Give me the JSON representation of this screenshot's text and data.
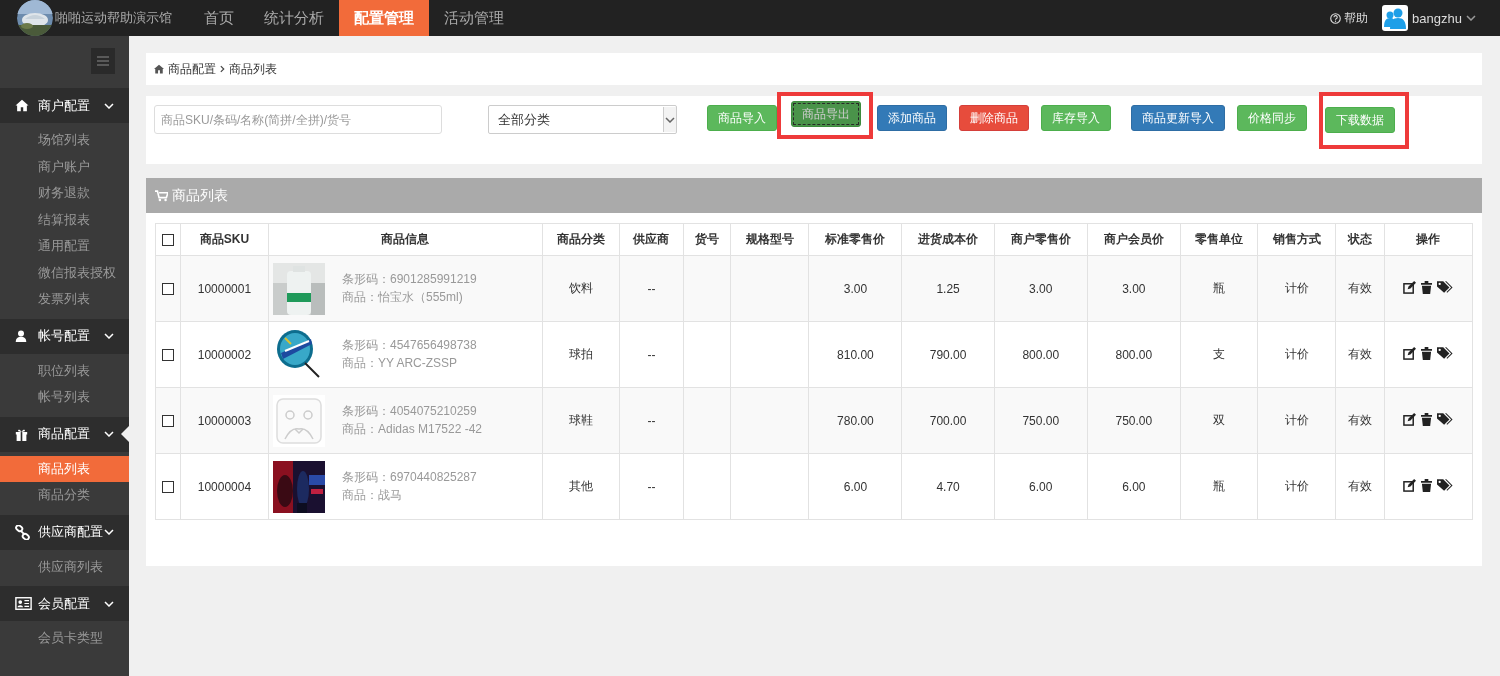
{
  "topbar": {
    "site_name": "啪啪运动帮助演示馆",
    "nav": [
      {
        "label": "首页",
        "selected": false
      },
      {
        "label": "统计分析",
        "selected": false
      },
      {
        "label": "配置管理",
        "selected": true
      },
      {
        "label": "活动管理",
        "selected": false
      }
    ],
    "help": "帮助",
    "user": "bangzhu"
  },
  "sidebar": {
    "sections": [
      {
        "label": "商户配置",
        "expanded": true,
        "active": false,
        "children": [
          {
            "label": "场馆列表",
            "selected": false
          },
          {
            "label": "商户账户",
            "selected": false
          },
          {
            "label": "财务退款",
            "selected": false
          },
          {
            "label": "结算报表",
            "selected": false
          },
          {
            "label": "通用配置",
            "selected": false
          },
          {
            "label": "微信报表授权",
            "selected": false
          },
          {
            "label": "发票列表",
            "selected": false
          }
        ]
      },
      {
        "label": "帐号配置",
        "expanded": true,
        "active": false,
        "children": [
          {
            "label": "职位列表",
            "selected": false
          },
          {
            "label": "帐号列表",
            "selected": false
          }
        ]
      },
      {
        "label": "商品配置",
        "expanded": true,
        "active": true,
        "children": [
          {
            "label": "商品列表",
            "selected": true
          },
          {
            "label": "商品分类",
            "selected": false
          }
        ]
      },
      {
        "label": "供应商配置",
        "expanded": true,
        "active": false,
        "children": [
          {
            "label": "供应商列表",
            "selected": false
          }
        ]
      },
      {
        "label": "会员配置",
        "expanded": true,
        "active": false,
        "children": [
          {
            "label": "会员卡类型",
            "selected": false
          }
        ]
      }
    ]
  },
  "breadcrumb": [
    "商品配置",
    "商品列表"
  ],
  "toolbar": {
    "search": {
      "placeholder": "商品SKU/条码/名称(简拼/全拼)/货号"
    },
    "category_select": "全部分类",
    "buttons": [
      {
        "label": "商品导入",
        "kind": "success",
        "pressed": false,
        "highlighted": false
      },
      {
        "label": "商品导出",
        "kind": "success",
        "pressed": true,
        "highlighted": true
      },
      {
        "label": "添加商品",
        "kind": "primary",
        "pressed": false,
        "highlighted": false
      },
      {
        "label": "删除商品",
        "kind": "danger",
        "pressed": false,
        "highlighted": false
      },
      {
        "label": "库存导入",
        "kind": "success",
        "pressed": false,
        "highlighted": false
      },
      {
        "label": "商品更新导入",
        "kind": "primary",
        "pressed": false,
        "highlighted": false
      },
      {
        "label": "价格同步",
        "kind": "success",
        "pressed": false,
        "highlighted": false
      },
      {
        "label": "下载数据",
        "kind": "success",
        "pressed": false,
        "highlighted": true
      }
    ]
  },
  "table": {
    "title": "商品列表",
    "header_checked": false,
    "columns": [
      "商品SKU",
      "商品信息",
      "商品分类",
      "供应商",
      "货号",
      "规格型号",
      "标准零售价",
      "进货成本价",
      "商户零售价",
      "商户会员价",
      "零售单位",
      "销售方式",
      "状态",
      "操作"
    ],
    "rows": [
      {
        "checked": false,
        "sku": "10000001",
        "barcode": "条形码：6901285991219",
        "name": "商品：怡宝水（555ml)",
        "category": "饮料",
        "supplier": "--",
        "price": "3.00",
        "cost": "1.25",
        "merchant_price": "3.00",
        "member_price": "3.00",
        "unit": "瓶",
        "sale_mode": "计价",
        "status": "有效"
      },
      {
        "checked": false,
        "sku": "10000002",
        "barcode": "条形码：4547656498738",
        "name": "商品：YY ARC-ZSSP",
        "category": "球拍",
        "supplier": "--",
        "price": "810.00",
        "cost": "790.00",
        "merchant_price": "800.00",
        "member_price": "800.00",
        "unit": "支",
        "sale_mode": "计价",
        "status": "有效"
      },
      {
        "checked": false,
        "sku": "10000003",
        "barcode": "条形码：4054075210259",
        "name": "商品：Adidas M17522 -42",
        "category": "球鞋",
        "supplier": "--",
        "price": "780.00",
        "cost": "700.00",
        "merchant_price": "750.00",
        "member_price": "750.00",
        "unit": "双",
        "sale_mode": "计价",
        "status": "有效"
      },
      {
        "checked": false,
        "sku": "10000004",
        "barcode": "条形码：6970440825287",
        "name": "商品：战马",
        "category": "其他",
        "supplier": "--",
        "price": "6.00",
        "cost": "4.70",
        "merchant_price": "6.00",
        "member_price": "6.00",
        "unit": "瓶",
        "sale_mode": "计价",
        "status": "有效"
      }
    ]
  }
}
